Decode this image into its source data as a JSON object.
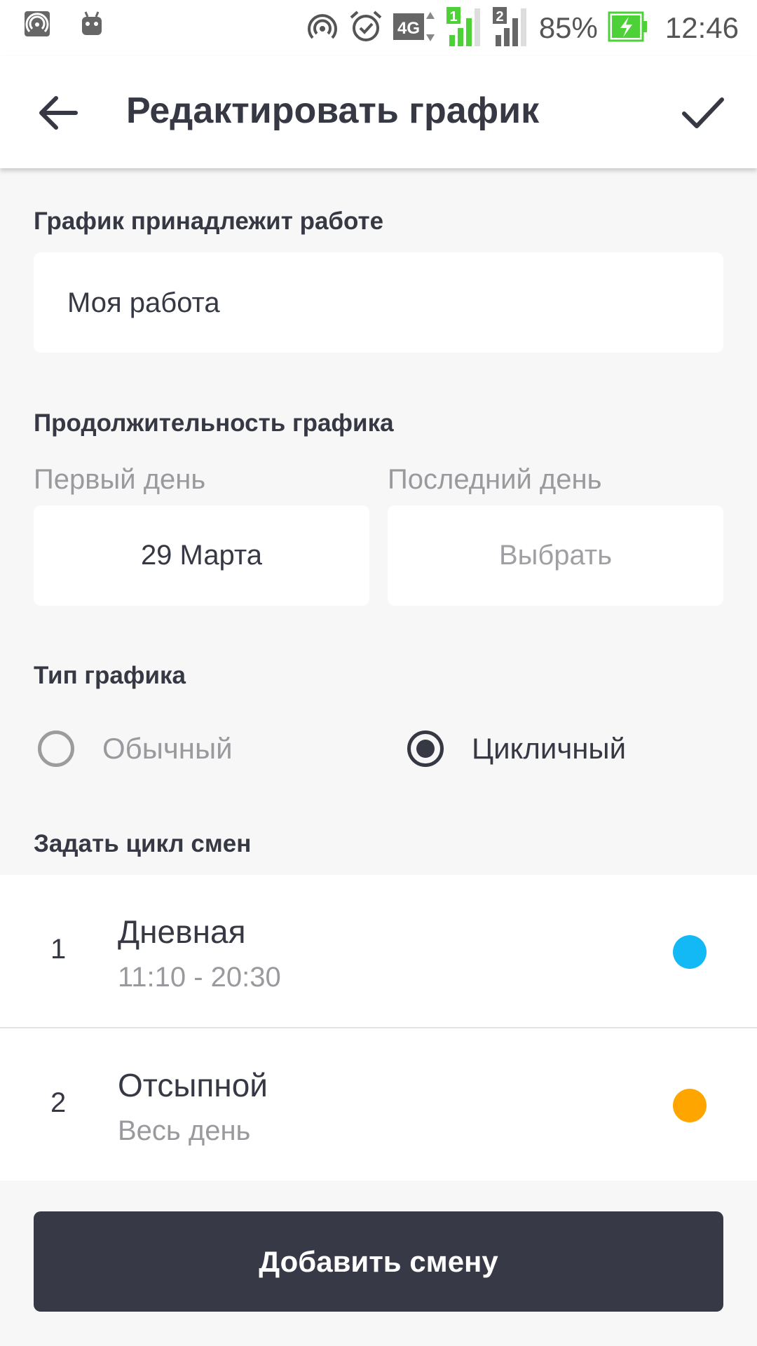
{
  "status_bar": {
    "battery": "85%",
    "time": "12:46",
    "icons": [
      "hotspot-icon",
      "android-icon",
      "wifi-icon",
      "alarm-icon",
      "4g-icon",
      "signal-sim1-icon",
      "signal-sim2-icon",
      "battery-charging-icon"
    ],
    "sim1": "1",
    "sim2": "2",
    "network": "4G"
  },
  "header": {
    "title": "Редактировать график",
    "back_icon": "arrow-left-icon",
    "confirm_icon": "check-icon"
  },
  "job": {
    "label": "График принадлежит работе",
    "value": "Моя работа"
  },
  "duration": {
    "label": "Продолжительность графика",
    "first_day_label": "Первый день",
    "first_day_value": "29 Марта",
    "last_day_label": "Последний день",
    "last_day_value": "Выбрать"
  },
  "schedule_type": {
    "label": "Тип графика",
    "options": [
      {
        "label": "Обычный",
        "selected": false
      },
      {
        "label": "Цикличный",
        "selected": true
      }
    ]
  },
  "cycle": {
    "label": "Задать цикл смен",
    "shifts": [
      {
        "number": "1",
        "name": "Дневная",
        "time": "11:10 - 20:30",
        "color": "#13b9f5"
      },
      {
        "number": "2",
        "name": "Отсыпной",
        "time": "Весь день",
        "color": "#ffa500"
      }
    ]
  },
  "add_button": {
    "label": "Добавить смену"
  },
  "colors": {
    "background": "#f7f7f7",
    "primary_dark": "#373946",
    "battery_green": "#4cd137"
  }
}
